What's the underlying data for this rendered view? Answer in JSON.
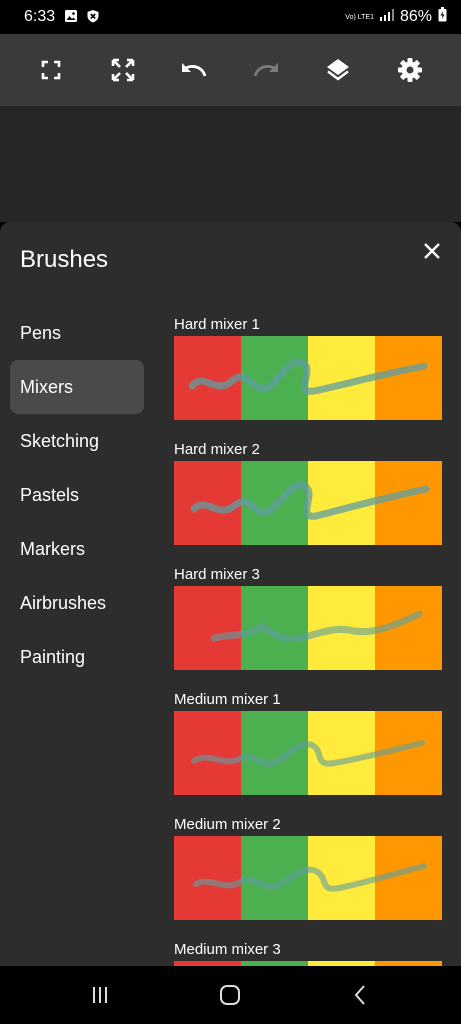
{
  "status": {
    "time": "6:33",
    "network": "Vo) LTE1",
    "battery": "86%"
  },
  "panel": {
    "title": "Brushes"
  },
  "categories": [
    {
      "label": "Pens",
      "active": false
    },
    {
      "label": "Mixers",
      "active": true
    },
    {
      "label": "Sketching",
      "active": false
    },
    {
      "label": "Pastels",
      "active": false
    },
    {
      "label": "Markers",
      "active": false
    },
    {
      "label": "Airbrushes",
      "active": false
    },
    {
      "label": "Painting",
      "active": false
    }
  ],
  "brushes": [
    {
      "name": "Hard mixer 1"
    },
    {
      "name": "Hard mixer 2"
    },
    {
      "name": "Hard mixer 3"
    },
    {
      "name": "Medium mixer 1"
    },
    {
      "name": "Medium mixer 2"
    },
    {
      "name": "Medium mixer 3"
    }
  ],
  "colors": {
    "toolbar_bg": "#3a3a3a",
    "panel_bg": "#2d2d2d",
    "active_item_bg": "#4a4a4a",
    "swatch_red": "#e53935",
    "swatch_green": "#4caf50",
    "swatch_yellow": "#ffeb3b",
    "swatch_orange": "#ff9800",
    "stroke_color": "#5f9ea0"
  },
  "icons": {
    "toolbar": [
      "fullscreen-icon",
      "expand-icon",
      "undo-icon",
      "redo-icon",
      "layers-icon",
      "settings-icon"
    ],
    "nav": [
      "recents-icon",
      "home-icon",
      "back-icon"
    ]
  }
}
